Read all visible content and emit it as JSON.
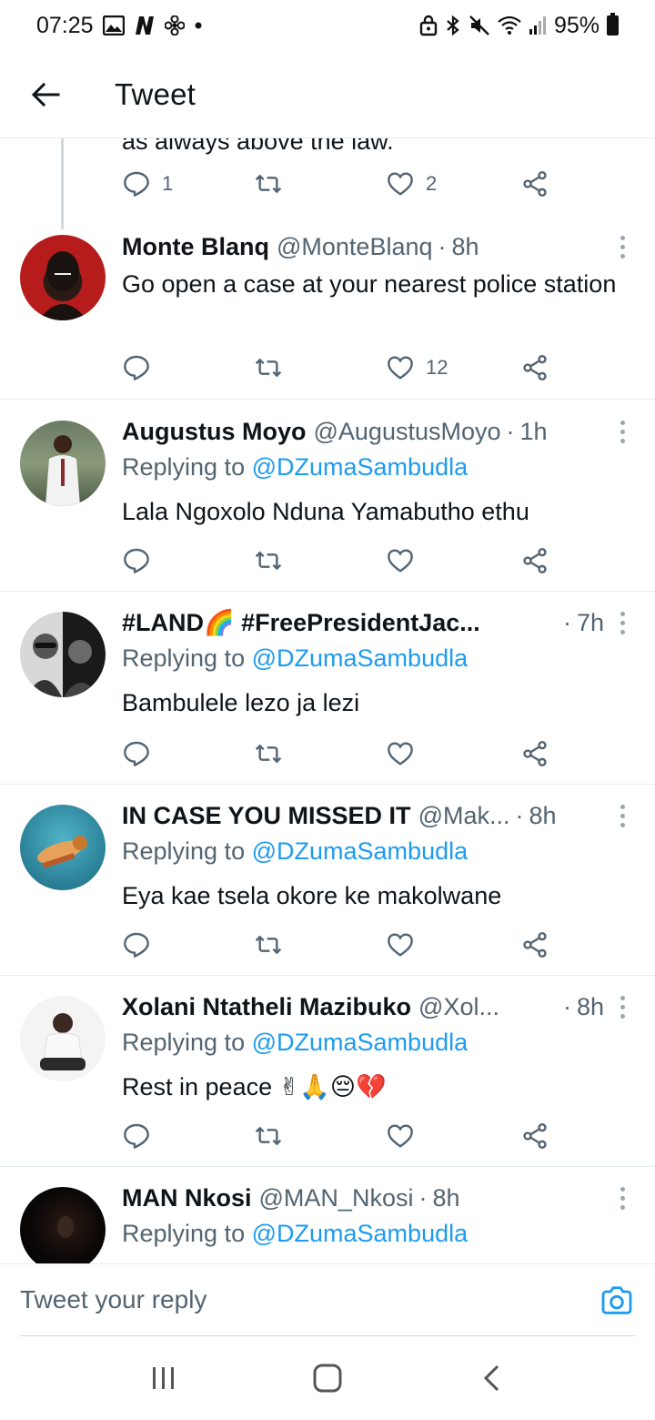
{
  "status_bar": {
    "time": "07:25",
    "battery": "95%",
    "icons_left": [
      "gallery-icon",
      "netflix-icon",
      "fan-icon",
      "dot-icon"
    ],
    "icons_right": [
      "lock-icon",
      "bluetooth-icon",
      "mute-icon",
      "wifi-icon",
      "signal-icon",
      "battery-icon"
    ]
  },
  "header": {
    "title": "Tweet"
  },
  "partial_tweet": {
    "cutoff_text": "as always above the law.",
    "reply_count": "1",
    "retweet_count": "",
    "like_count": "2"
  },
  "tweets": [
    {
      "name": "Monte Blanq",
      "handle": "@MonteBlanq",
      "time": "8h",
      "replying_to": "",
      "text": "Go open a case at your nearest police station",
      "reply_count": "",
      "retweet_count": "",
      "like_count": "12"
    },
    {
      "name": "Augustus Moyo",
      "handle": "@AugustusMoyo",
      "time": "1h",
      "replying_label": "Replying to",
      "replying_to": "@DZumaSambudla",
      "text": "Lala Ngoxolo Nduna Yamabutho ethu",
      "reply_count": "",
      "retweet_count": "",
      "like_count": ""
    },
    {
      "name": "#LAND🌈 #FreePresidentJac...",
      "handle": "",
      "time": "7h",
      "replying_label": "Replying to",
      "replying_to": "@DZumaSambudla",
      "text": "Bambulele lezo ja lezi",
      "reply_count": "",
      "retweet_count": "",
      "like_count": ""
    },
    {
      "name": "IN CASE YOU MISSED IT",
      "handle": "@Mak...",
      "time": "8h",
      "replying_label": "Replying to",
      "replying_to": "@DZumaSambudla",
      "text": "Eya kae tsela okore ke makolwane",
      "reply_count": "",
      "retweet_count": "",
      "like_count": ""
    },
    {
      "name": "Xolani Ntatheli Mazibuko",
      "handle": "@Xol...",
      "time": "8h",
      "replying_label": "Replying to",
      "replying_to": "@DZumaSambudla",
      "text": "Rest in peace ✌🙏😔💔",
      "reply_count": "",
      "retweet_count": "",
      "like_count": ""
    },
    {
      "name": "MAN Nkosi",
      "handle": "@MAN_Nkosi",
      "time": "8h",
      "replying_label": "Replying to",
      "replying_to": "@DZumaSambudla",
      "text": ""
    }
  ],
  "composer": {
    "placeholder": "Tweet your reply"
  },
  "colors": {
    "accent": "#1d9bf0",
    "text_secondary": "#536471",
    "divider": "#e6ecf0"
  }
}
